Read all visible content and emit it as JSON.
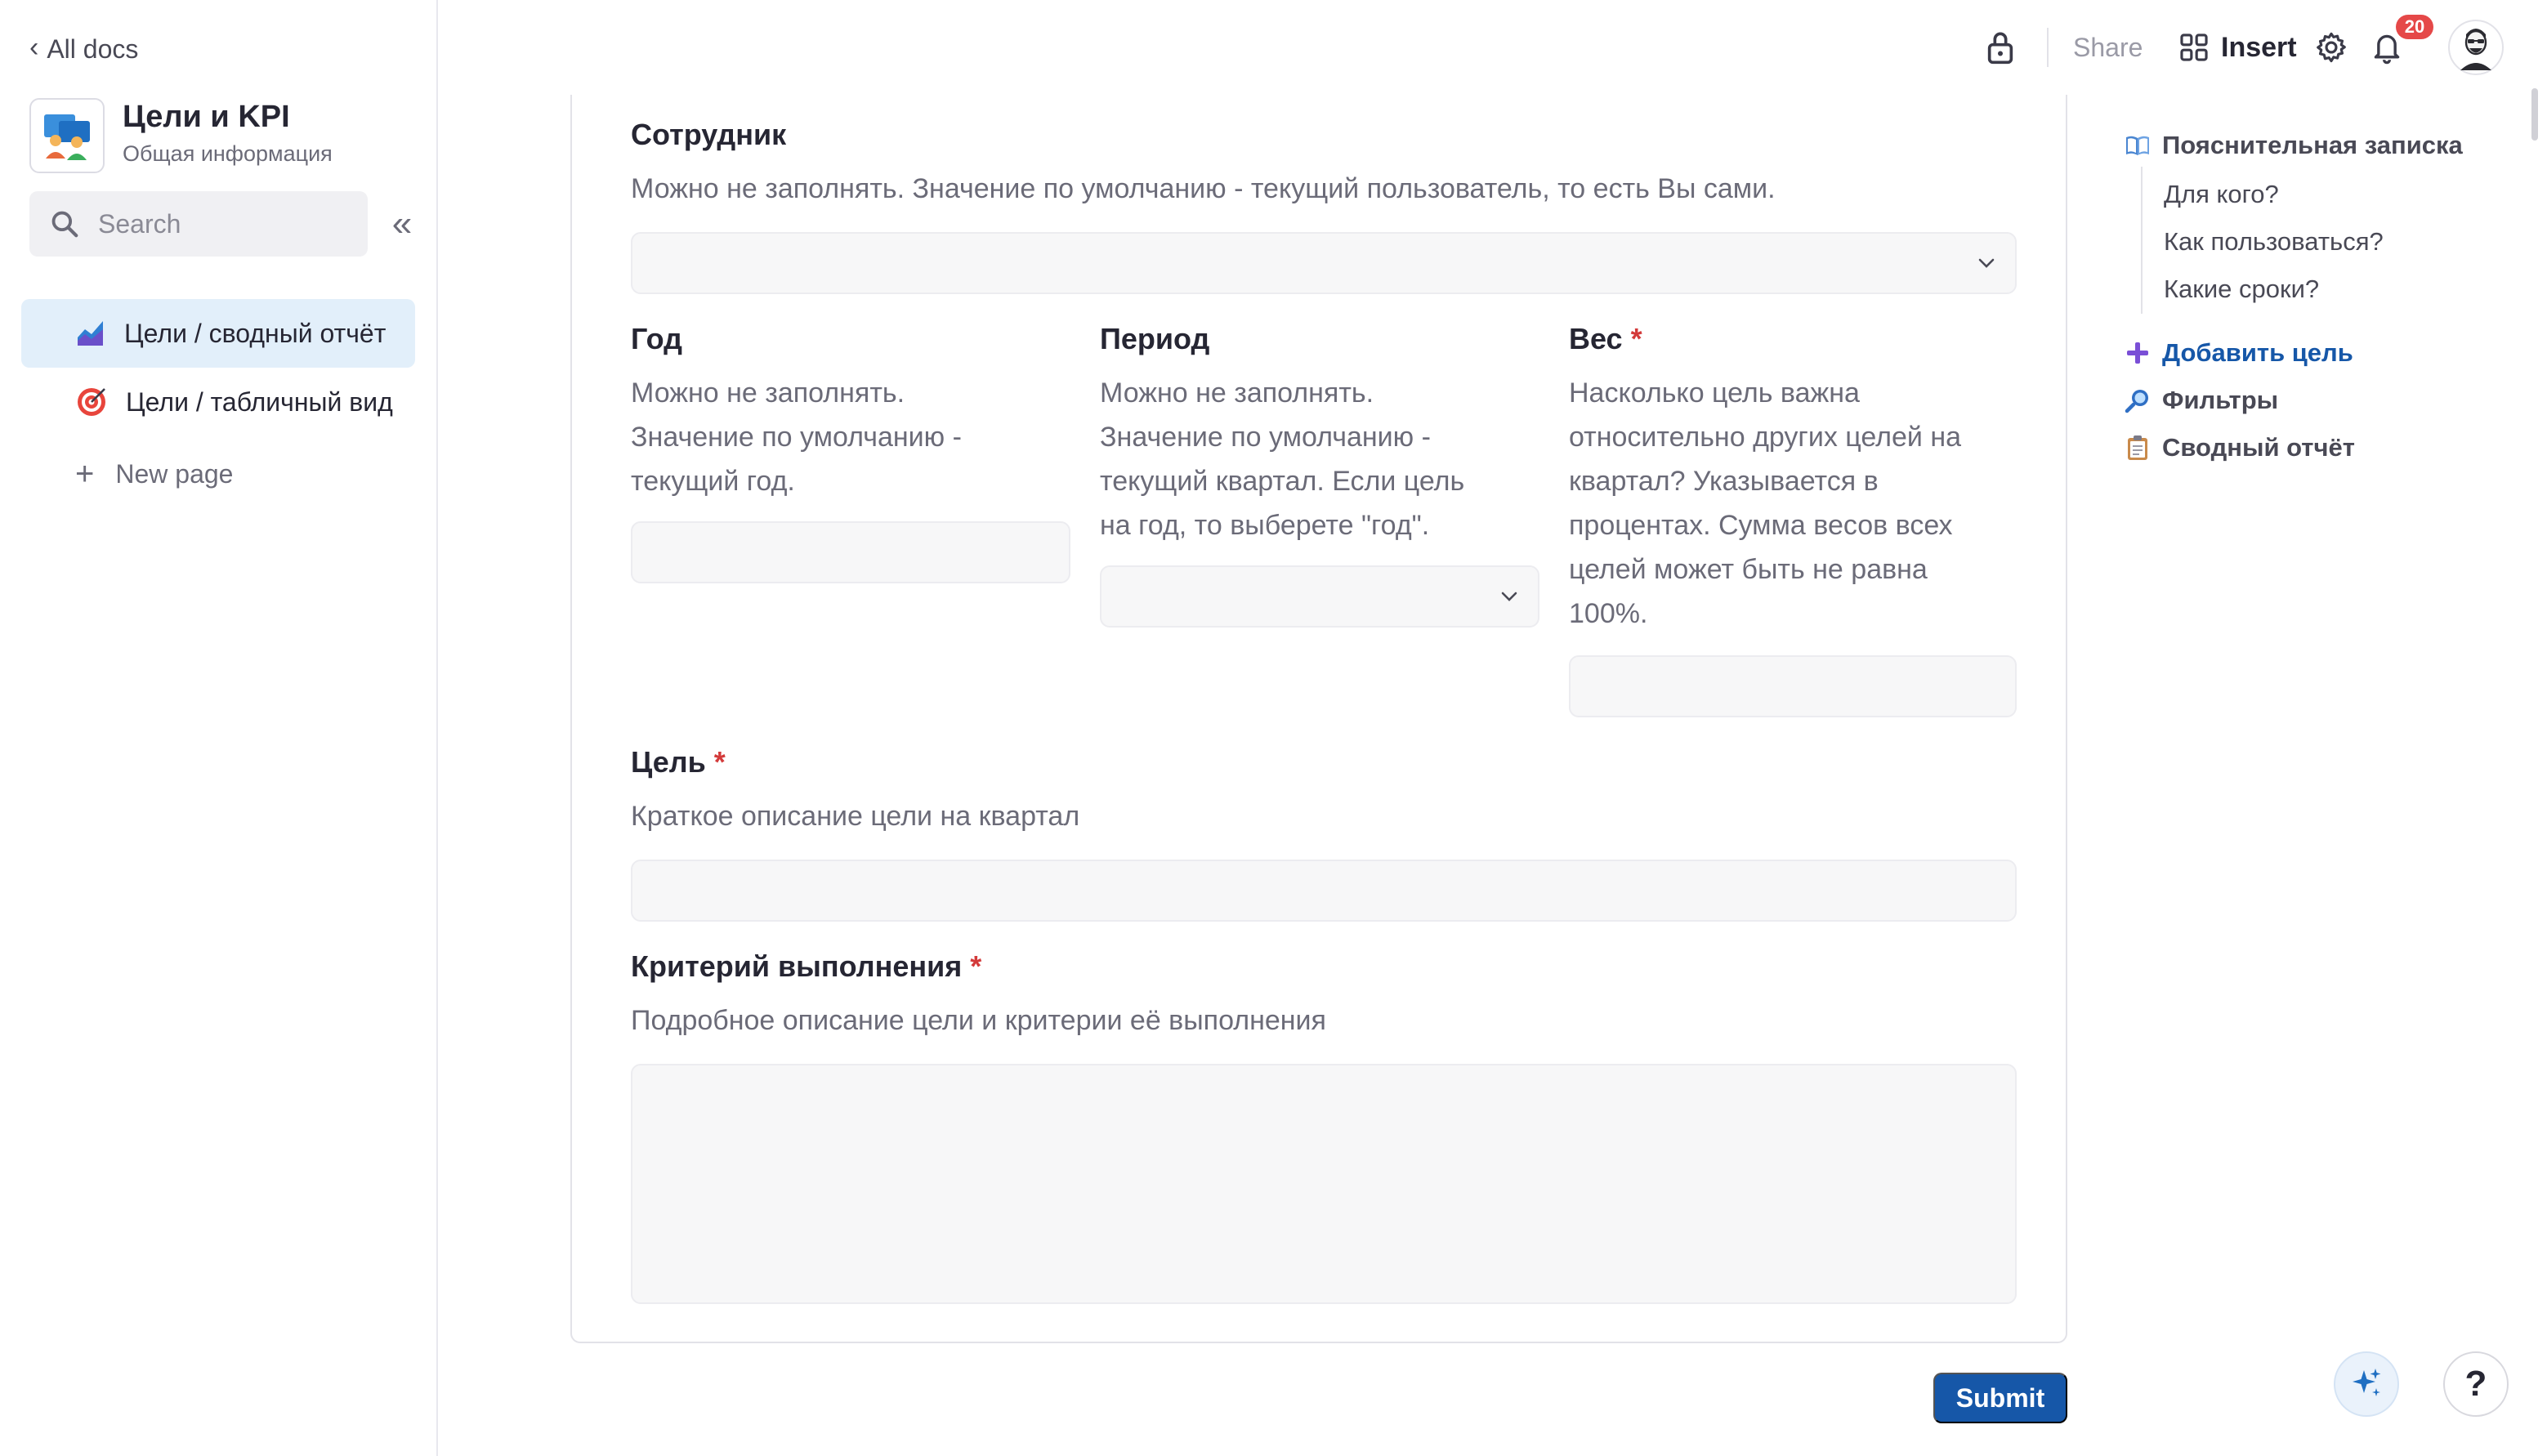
{
  "sidebar": {
    "back_label": "All docs",
    "doc_title": "Цели и KPI",
    "doc_subtitle": "Общая информация",
    "search_placeholder": "Search",
    "pages": [
      {
        "label": "Цели / сводный отчёт"
      },
      {
        "label": "Цели / табличный вид"
      }
    ],
    "new_page_label": "New page"
  },
  "topbar": {
    "share_label": "Share",
    "insert_label": "Insert",
    "notification_count": "20"
  },
  "form": {
    "employee": {
      "label": "Сотрудник",
      "description": "Можно не заполнять. Значение по умолчанию - текущий пользователь, то есть Вы сами."
    },
    "year": {
      "label": "Год",
      "description_lines": [
        "Можно не заполнять.",
        "Значение по умолчанию -",
        "текущий год."
      ]
    },
    "period": {
      "label": "Период",
      "description_lines": [
        "Можно не заполнять.",
        "Значение по умолчанию -",
        "текущий квартал. Если цель",
        "на год, то выберете \"год\"."
      ]
    },
    "weight": {
      "label": "Вес",
      "required_mark": "*",
      "description_lines": [
        "Насколько цель важна",
        "относительно других целей на",
        "квартал? Указывается в",
        "процентах. Сумма весов всех",
        "целей может быть не равна",
        "100%."
      ]
    },
    "goal": {
      "label": "Цель",
      "required_mark": "*",
      "description": "Краткое описание цели на квартал"
    },
    "criteria": {
      "label": "Критерий выполнения",
      "required_mark": "*",
      "description": "Подробное описание цели и критерии её выполнения"
    },
    "submit_label": "Submit"
  },
  "toc": {
    "items": [
      {
        "label": "Пояснительная записка"
      },
      {
        "label": "Для кого?"
      },
      {
        "label": "Как пользоваться?"
      },
      {
        "label": "Какие сроки?"
      },
      {
        "label": "Добавить цель"
      },
      {
        "label": "Фильтры"
      },
      {
        "label": "Сводный отчёт"
      }
    ]
  },
  "help_label": "?",
  "colors": {
    "accent": "#1657a8",
    "active_page_bg": "#e2effa",
    "required": "#d33a3a",
    "badge": "#e54848"
  },
  "icons": {
    "back": "chevron-left-icon",
    "search": "search-icon",
    "collapse": "double-chevron-left-icon",
    "lock": "lock-icon",
    "insert": "grid-icon",
    "settings": "gear-icon",
    "notifications": "bell-icon",
    "ai": "sparkles-icon"
  }
}
